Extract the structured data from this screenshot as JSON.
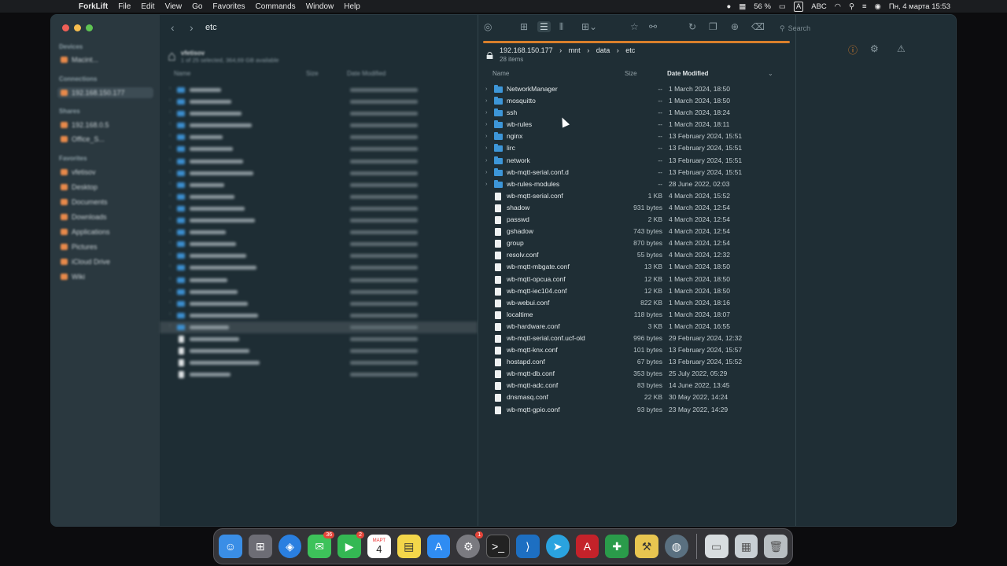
{
  "menubar": {
    "app_name": "ForkLift",
    "items": [
      "File",
      "Edit",
      "View",
      "Go",
      "Favorites",
      "Commands",
      "Window",
      "Help"
    ],
    "battery": "56 %",
    "keyboard": "ABC",
    "clock": "Пн, 4 марта 15:53"
  },
  "left": {
    "title": "etc",
    "header": {
      "name": "Name",
      "size": "Size",
      "date": "Date Modified"
    }
  },
  "right": {
    "host": "192.168.150.177",
    "crumbs": [
      "mnt",
      "data",
      "etc"
    ],
    "count": "28 items",
    "header": {
      "name": "Name",
      "size": "Size",
      "date": "Date Modified"
    },
    "search_placeholder": "Search",
    "rows": [
      {
        "name": "NetworkManager",
        "size": "--",
        "date": "1 March 2024, 18:50",
        "type": "folder"
      },
      {
        "name": "mosquitto",
        "size": "--",
        "date": "1 March 2024, 18:50",
        "type": "folder"
      },
      {
        "name": "ssh",
        "size": "--",
        "date": "1 March 2024, 18:24",
        "type": "folder"
      },
      {
        "name": "wb-rules",
        "size": "--",
        "date": "1 March 2024, 18:11",
        "type": "folder"
      },
      {
        "name": "nginx",
        "size": "--",
        "date": "13 February 2024, 15:51",
        "type": "folder"
      },
      {
        "name": "lirc",
        "size": "--",
        "date": "13 February 2024, 15:51",
        "type": "folder"
      },
      {
        "name": "network",
        "size": "--",
        "date": "13 February 2024, 15:51",
        "type": "folder"
      },
      {
        "name": "wb-mqtt-serial.conf.d",
        "size": "--",
        "date": "13 February 2024, 15:51",
        "type": "folder"
      },
      {
        "name": "wb-rules-modules",
        "size": "--",
        "date": "28 June 2022, 02:03",
        "type": "folder"
      },
      {
        "name": "wb-mqtt-serial.conf",
        "size": "1 KB",
        "date": "4 March 2024, 15:52",
        "type": "file"
      },
      {
        "name": "shadow",
        "size": "931 bytes",
        "date": "4 March 2024, 12:54",
        "type": "file"
      },
      {
        "name": "passwd",
        "size": "2 KB",
        "date": "4 March 2024, 12:54",
        "type": "file"
      },
      {
        "name": "gshadow",
        "size": "743 bytes",
        "date": "4 March 2024, 12:54",
        "type": "file"
      },
      {
        "name": "group",
        "size": "870 bytes",
        "date": "4 March 2024, 12:54",
        "type": "file"
      },
      {
        "name": "resolv.conf",
        "size": "55 bytes",
        "date": "4 March 2024, 12:32",
        "type": "file"
      },
      {
        "name": "wb-mqtt-mbgate.conf",
        "size": "13 KB",
        "date": "1 March 2024, 18:50",
        "type": "file"
      },
      {
        "name": "wb-mqtt-opcua.conf",
        "size": "12 KB",
        "date": "1 March 2024, 18:50",
        "type": "file"
      },
      {
        "name": "wb-mqtt-iec104.conf",
        "size": "12 KB",
        "date": "1 March 2024, 18:50",
        "type": "file"
      },
      {
        "name": "wb-webui.conf",
        "size": "822 KB",
        "date": "1 March 2024, 18:16",
        "type": "file"
      },
      {
        "name": "localtime",
        "size": "118 bytes",
        "date": "1 March 2024, 18:07",
        "type": "file"
      },
      {
        "name": "wb-hardware.conf",
        "size": "3 KB",
        "date": "1 March 2024, 16:55",
        "type": "file"
      },
      {
        "name": "wb-mqtt-serial.conf.ucf-old",
        "size": "996 bytes",
        "date": "29 February 2024, 12:32",
        "type": "file"
      },
      {
        "name": "wb-mqtt-knx.conf",
        "size": "101 bytes",
        "date": "13 February 2024, 15:57",
        "type": "file"
      },
      {
        "name": "hostapd.conf",
        "size": "67 bytes",
        "date": "13 February 2024, 15:52",
        "type": "file"
      },
      {
        "name": "wb-mqtt-db.conf",
        "size": "353 bytes",
        "date": "25 July 2022, 05:29",
        "type": "file"
      },
      {
        "name": "wb-mqtt-adc.conf",
        "size": "83 bytes",
        "date": "14 June 2022, 13:45",
        "type": "file"
      },
      {
        "name": "dnsmasq.conf",
        "size": "22 KB",
        "date": "30 May 2022, 14:24",
        "type": "file"
      },
      {
        "name": "wb-mqtt-gpio.conf",
        "size": "93 bytes",
        "date": "23 May 2022, 14:29",
        "type": "file"
      }
    ]
  },
  "dock": {
    "badges": {
      "messages": "36",
      "facetime": "2",
      "settings": "1"
    },
    "calendar_month": "МАРТ",
    "calendar_day": "4"
  },
  "colors": {
    "accent": "#d97f2c",
    "folder": "#3d96d8",
    "bg": "#1f2e35"
  }
}
